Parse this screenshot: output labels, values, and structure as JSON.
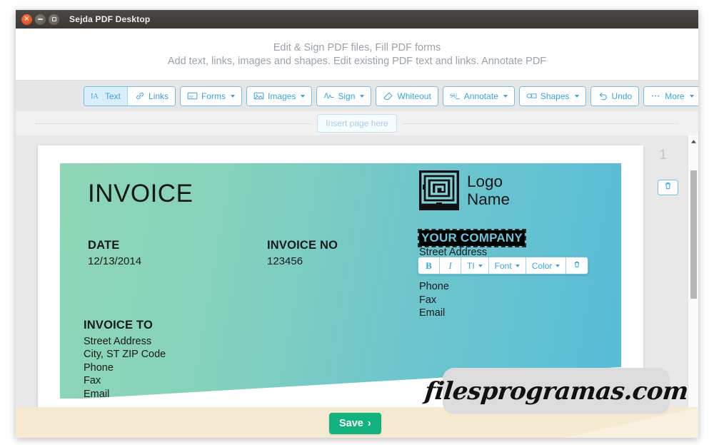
{
  "window": {
    "title": "Sejda PDF Desktop",
    "controls": [
      {
        "name": "close",
        "glyph": "×"
      },
      {
        "name": "minimize",
        "glyph": "−"
      },
      {
        "name": "maximize",
        "glyph": "□"
      }
    ]
  },
  "header": {
    "line1": "Edit & Sign PDF files, Fill PDF forms",
    "line2": "Add text, links, images and shapes. Edit existing PDF text and links. Annotate PDF"
  },
  "toolbar": {
    "buttons": [
      {
        "label": "Text",
        "icon": "text-icon",
        "caret": false,
        "active": true
      },
      {
        "label": "Links",
        "icon": "link-icon",
        "caret": false,
        "active": false
      },
      {
        "label": "Forms",
        "icon": "forms-icon",
        "caret": true,
        "active": false
      },
      {
        "label": "Images",
        "icon": "image-icon",
        "caret": true,
        "active": false
      },
      {
        "label": "Sign",
        "icon": "signature-icon",
        "caret": true,
        "active": false
      },
      {
        "label": "Whiteout",
        "icon": "eraser-icon",
        "caret": false,
        "active": false
      },
      {
        "label": "Annotate",
        "icon": "annotate-icon",
        "caret": true,
        "active": false
      },
      {
        "label": "Shapes",
        "icon": "shapes-icon",
        "caret": true,
        "active": false
      },
      {
        "label": "Undo",
        "icon": "undo-icon",
        "caret": false,
        "active": false
      },
      {
        "label": "More",
        "icon": "ellipsis-icon",
        "caret": true,
        "active": false
      }
    ]
  },
  "insert_page": {
    "label": "Insert page here"
  },
  "format_toolbar": {
    "bold": "B",
    "italic": "I",
    "text_size": "TI",
    "font": "Font",
    "color": "Color",
    "delete_icon": "trash-icon"
  },
  "gutter": {
    "page_number": "1",
    "delete_icon": "trash-icon"
  },
  "document": {
    "title": "INVOICE",
    "date": {
      "label": "DATE",
      "value": "12/13/2014"
    },
    "invoice_no": {
      "label": "INVOICE NO",
      "value": "123456"
    },
    "logo": {
      "icon": "maze-logo-icon",
      "line1": "Logo",
      "line2": "Name"
    },
    "company": {
      "name": "YOUR COMPANY",
      "selected": true,
      "lines": [
        "Street Address",
        "Phone",
        "Fax",
        "Email"
      ]
    },
    "invoice_to": {
      "label": "INVOICE TO",
      "lines": [
        "Street Address",
        "City, ST ZIP Code",
        "Phone",
        "Fax",
        "Email"
      ]
    }
  },
  "footer": {
    "save_label": "Save",
    "save_chevron": "›"
  },
  "watermark": {
    "text": "filesprogramas.com"
  },
  "colors": {
    "accent": "#3aa3dd",
    "save_green": "#13b37f",
    "doc_gradient_start": "#8ed6b6",
    "doc_gradient_end": "#58bcd8",
    "footer_band": "#f6e9d2",
    "titlebar": "#3c3835"
  }
}
